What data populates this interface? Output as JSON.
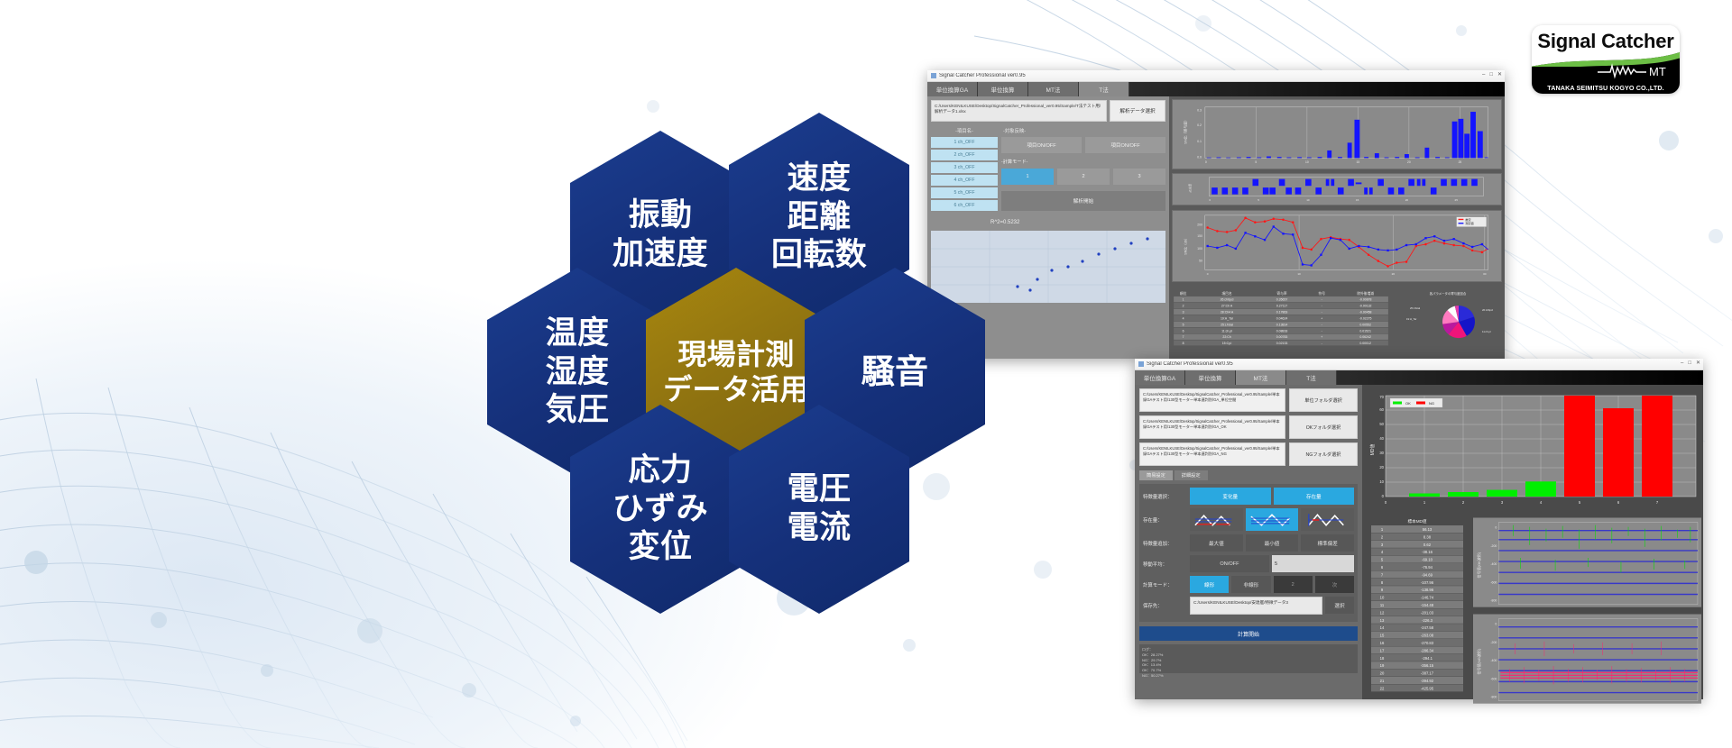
{
  "page": {
    "title": "現場計測データ活用 — Signal Catcher MT"
  },
  "logo": {
    "name": "Signal Catcher",
    "model": "MT",
    "company": "TANAKA SEIMITSU KOGYO CO.,LTD.",
    "green": "#6cbe45",
    "black": "#000000"
  },
  "hexagons": {
    "center": {
      "lines": [
        "現場計測",
        "データ活用"
      ],
      "color": "#8d7110"
    },
    "items": [
      {
        "id": "vibration",
        "lines": [
          "振動",
          "加速度"
        ],
        "color": "#15307a"
      },
      {
        "id": "speed",
        "lines": [
          "速度",
          "距離",
          "回転数"
        ],
        "color": "#15307a"
      },
      {
        "id": "temperature",
        "lines": [
          "温度",
          "湿度",
          "気圧"
        ],
        "color": "#15307a"
      },
      {
        "id": "noise",
        "lines": [
          "騒音"
        ],
        "color": "#15307a"
      },
      {
        "id": "stress",
        "lines": [
          "応力",
          "ひずみ",
          "変位"
        ],
        "color": "#15307a"
      },
      {
        "id": "voltage",
        "lines": [
          "電圧",
          "電流"
        ],
        "color": "#15307a"
      }
    ]
  },
  "window_top": {
    "title": "Signal Catcher Professional ver0.95",
    "tabs": [
      "単位換算GA",
      "単位換算",
      "MT法",
      "T法"
    ],
    "selected_tab": "T法",
    "path_value": "C:/Users/KENILKUSE/Desktop/SignalCatcher_Professional_ver0.95/Sample/T法テスト用/解析データ1.xlsx",
    "select_button": "解析データ選択",
    "col_headers": [
      "-項目名-",
      "-対象反映-"
    ],
    "channels": [
      "1 ch_OFF",
      "2 ch_OFF",
      "3 ch_OFF",
      "4 ch_OFF",
      "5 ch_OFF",
      "6 ch_OFF"
    ],
    "toggle_buttons": [
      "項目ON/OFF",
      "項目ON/OFF"
    ],
    "mode_label": "-計算モード-",
    "mode_buttons": [
      "1",
      "2",
      "3"
    ],
    "run_button": "解析開始",
    "r2_label": "R^2=0.5232",
    "chart1": {
      "type": "bar",
      "ylabel": "SN比（寄与度）",
      "ylim": [
        0.0,
        0.3
      ],
      "yticks": [
        0.0,
        0.1,
        0.2,
        0.3
      ],
      "xticks": [
        0,
        5,
        10,
        15,
        20,
        25
      ],
      "values": [
        0.003,
        0.004,
        0.003,
        0.004,
        0.006,
        0.004,
        0.009,
        0.006,
        0.004,
        0.005,
        0.004,
        0.006,
        0.044,
        0.006,
        0.097,
        0.243,
        0.006,
        0.03,
        0.004,
        0.006,
        0.025,
        0.004,
        0.066,
        0.006,
        0.004,
        0.23,
        0.25,
        0.13,
        0.29,
        0.15,
        0.005
      ],
      "bar_color": "#1414ff"
    },
    "chart2": {
      "type": "bar",
      "ylabel": "水準",
      "values_label": "±1",
      "xticks": [
        0,
        5,
        10,
        15,
        20,
        25
      ],
      "bar_color": "#1414ff"
    },
    "chart3": {
      "type": "line",
      "ylabel": "SN比（db）",
      "ylim": [
        0,
        250
      ],
      "yticks": [
        50,
        100,
        150,
        200
      ],
      "xticks": [
        0,
        10,
        20,
        30
      ],
      "series": [
        {
          "name": "推定",
          "color": "#ff1818",
          "values": [
            193,
            180,
            178,
            182,
            233,
            215,
            219,
            228,
            224,
            216,
            115,
            108,
            150,
            157,
            149,
            145,
            120,
            85,
            60,
            42,
            58,
            62,
            118,
            125,
            140,
            130,
            122,
            118,
            100,
            95,
            110
          ]
        },
        {
          "name": "測定値",
          "color": "#1414ff",
          "values": [
            125,
            118,
            130,
            115,
            170,
            155,
            140,
            188,
            160,
            158,
            62,
            60,
            90,
            142,
            135,
            108,
            118,
            116,
            105,
            100,
            103,
            115,
            120,
            135,
            143,
            130,
            138,
            122,
            110,
            118,
            104
          ]
        }
      ],
      "legend": [
        "推定",
        "測定値"
      ]
    },
    "table": {
      "headers": [
        "順位",
        "項目名",
        "寄与率",
        "符号",
        "除外後増減"
      ],
      "rows": [
        [
          "1",
          "26:ch6pcl",
          "0.35657",
          "-",
          "-0.00878"
        ],
        [
          "2",
          "27:Ch A",
          "0.27117",
          "-",
          "-0.00132"
        ],
        [
          "3",
          "28:Ch4 A",
          "0.17863",
          "-",
          "-0.00458"
        ],
        [
          "4",
          "19:H_Tar",
          "0.04624",
          "+",
          "-0.02275"
        ],
        [
          "5",
          "25:LTotal",
          "0.13814",
          "-",
          "0.00552"
        ],
        [
          "6",
          "11:ch.pl",
          "0.08818",
          "-",
          "0.01521"
        ],
        [
          "7",
          "22:Ch",
          "0.00783",
          "+",
          "0.06242"
        ],
        [
          "8",
          "15:Cy.l",
          "0.02133",
          "-",
          "0.00012"
        ]
      ]
    },
    "pie": {
      "type": "pie",
      "title": "各パラメータの寄与度割合",
      "labels": [
        "28:ch6pcl",
        "27:Ch A",
        "26:Ch4 A",
        "19:H_Tar",
        "25:LTotal",
        "11:ch.pl"
      ],
      "values": [
        35.7,
        27.1,
        17.9,
        4.6,
        13.8,
        0.9
      ],
      "colors": [
        "#f0147a",
        "#b9199e",
        "#e33aa8",
        "#ffffff",
        "#2a2ad8",
        "#ff7ac0"
      ]
    }
  },
  "window_bottom": {
    "title": "Signal Catcher Professional ver0.95",
    "tabs": [
      "単位換算GA",
      "単位換算",
      "MT法",
      "T法"
    ],
    "selected_tab": "MT法",
    "paths": [
      {
        "value": "C:/Users/KENILKUSE/Desktop/SignalCatcher_Professional_ver0.95/Sample/単本録GAテスト用/130型モーター単本連判別/GA_単位空間",
        "button": "単位フォルダ選択"
      },
      {
        "value": "C:/Users/KENILKUSE/Desktop/SignalCatcher_Professional_ver0.95/Sample/単本録GAテスト用/130型モーター単本連判別/GA_OK",
        "button": "OKフォルダ選択"
      },
      {
        "value": "C:/Users/KENILKUSE/Desktop/SignalCatcher_Professional_ver0.95/Sample/単本録GAテスト用/130型モーター単本連判別/GA_NG",
        "button": "NGフォルダ選択"
      }
    ],
    "subtabs": [
      "簡易設定",
      "詳細設定"
    ],
    "selected_subtab": "簡易設定",
    "form": [
      {
        "label": "特徴量選択：",
        "type": "buttons",
        "options": [
          "変化量",
          "存在量"
        ],
        "selected": "変化量"
      },
      {
        "label": "存在量：",
        "type": "wave",
        "options": [
          "wave-a",
          "wave-b",
          "wave-c"
        ],
        "selected": "wave-b"
      },
      {
        "label": "特徴量追加：",
        "type": "buttons",
        "options": [
          "最大値",
          "最小値",
          "標準偏差"
        ],
        "selected": ""
      },
      {
        "label": "移動平均：",
        "type": "toggle",
        "options": [
          "ON/OFF"
        ],
        "value": "5"
      },
      {
        "label": "計算モード：",
        "type": "buttons",
        "options": [
          "線形",
          "非線形",
          "2",
          "次"
        ],
        "selected": "線形"
      },
      {
        "label": "保存先：",
        "type": "path",
        "value": "C:/Users/KENILKUSE/Desktop/安達艦/特徴データ3",
        "button": "選択"
      }
    ],
    "start_button": "計算開始",
    "log_title": "ログ：",
    "log_lines": [
      "OK：28.27%",
      "NG：29.7%",
      "OK：13.4%",
      "OK：70.7%",
      "NG：50.27%"
    ],
    "md_chart": {
      "type": "bar",
      "ylabel": "MD値",
      "ylim": [
        0,
        72
      ],
      "yticks": [
        0,
        10,
        20,
        30,
        40,
        50,
        60,
        70
      ],
      "xticks": [
        0,
        1,
        2,
        3,
        4,
        5,
        6,
        7
      ],
      "legend": [
        {
          "label": "OK",
          "color": "#00ef00"
        },
        {
          "label": "NG",
          "color": "#ff0000"
        }
      ],
      "bars": [
        {
          "x": 1,
          "value": 2.2,
          "group": "OK"
        },
        {
          "x": 2,
          "value": 3.2,
          "group": "OK"
        },
        {
          "x": 3,
          "value": 4.6,
          "group": "OK"
        },
        {
          "x": 4,
          "value": 10.4,
          "group": "OK"
        },
        {
          "x": 5,
          "value": 72.0,
          "group": "NG"
        },
        {
          "x": 6,
          "value": 61.0,
          "group": "NG"
        },
        {
          "x": 7,
          "value": 72.0,
          "group": "NG"
        }
      ]
    },
    "md_table": {
      "title": "標本MD値",
      "headers": [
        "No.",
        "値"
      ],
      "rows": [
        [
          "1",
          "56.13"
        ],
        [
          "2",
          "8.38"
        ],
        [
          "3",
          "0.62"
        ],
        [
          "4",
          "-38.16"
        ],
        [
          "5",
          "-69.10"
        ],
        [
          "6",
          "-76.94"
        ],
        [
          "7",
          "-94.69"
        ],
        [
          "8",
          "-107.96"
        ],
        [
          "9",
          "-138.96"
        ],
        [
          "10",
          "-146.74"
        ],
        [
          "11",
          "-154.48"
        ],
        [
          "12",
          "-201.03"
        ],
        [
          "13",
          "-226.3"
        ],
        [
          "14",
          "-247.58"
        ],
        [
          "15",
          "-263.08"
        ],
        [
          "16",
          "-270.83"
        ],
        [
          "17",
          "-286.34"
        ],
        [
          "18",
          "-294.1"
        ],
        [
          "19",
          "-356.15"
        ],
        [
          "20",
          "-387.17"
        ],
        [
          "21",
          "-394.92"
        ],
        [
          "22",
          "-425.95"
        ]
      ]
    },
    "wave_ok": {
      "ylabel": "信号値(OK波形)",
      "yticks": [
        0,
        -200,
        -400,
        -600,
        -800
      ],
      "color": "#00d000"
    },
    "wave_ng": {
      "ylabel": "信号値(NG波形)",
      "yticks": [
        0,
        -200,
        -400,
        -600,
        -800
      ],
      "color": "#ff2070"
    }
  }
}
